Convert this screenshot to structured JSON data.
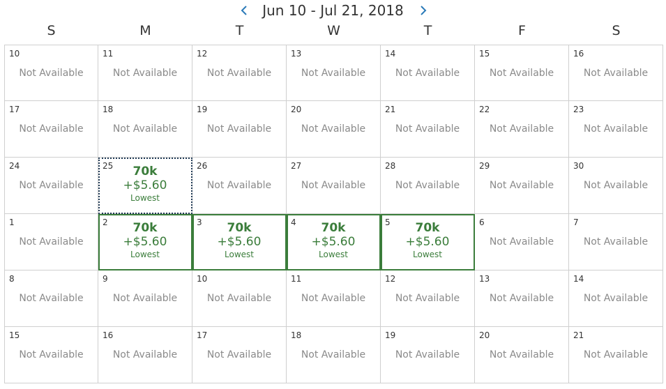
{
  "header": {
    "date_range": "Jun 10 - Jul 21, 2018",
    "prev_icon": "chevron-left-icon",
    "next_icon": "chevron-right-icon",
    "accent_color": "#2a7ab8"
  },
  "weekdays": [
    "S",
    "M",
    "T",
    "W",
    "T",
    "F",
    "S"
  ],
  "status_colors": {
    "available": "#3b7d3b",
    "not_available": "#8a8a8a"
  },
  "weeks": [
    [
      {
        "day": "10",
        "status": "Not Available"
      },
      {
        "day": "11",
        "status": "Not Available"
      },
      {
        "day": "12",
        "status": "Not Available"
      },
      {
        "day": "13",
        "status": "Not Available"
      },
      {
        "day": "14",
        "status": "Not Available"
      },
      {
        "day": "15",
        "status": "Not Available"
      },
      {
        "day": "16",
        "status": "Not Available"
      }
    ],
    [
      {
        "day": "17",
        "status": "Not Available"
      },
      {
        "day": "18",
        "status": "Not Available"
      },
      {
        "day": "19",
        "status": "Not Available"
      },
      {
        "day": "20",
        "status": "Not Available"
      },
      {
        "day": "21",
        "status": "Not Available"
      },
      {
        "day": "22",
        "status": "Not Available"
      },
      {
        "day": "23",
        "status": "Not Available"
      }
    ],
    [
      {
        "day": "24",
        "status": "Not Available"
      },
      {
        "day": "25",
        "points": "70k",
        "taxes": "+$5.60",
        "label": "Lowest",
        "focused": true
      },
      {
        "day": "26",
        "status": "Not Available"
      },
      {
        "day": "27",
        "status": "Not Available"
      },
      {
        "day": "28",
        "status": "Not Available"
      },
      {
        "day": "29",
        "status": "Not Available"
      },
      {
        "day": "30",
        "status": "Not Available"
      }
    ],
    [
      {
        "day": "1",
        "status": "Not Available"
      },
      {
        "day": "2",
        "points": "70k",
        "taxes": "+$5.60",
        "label": "Lowest"
      },
      {
        "day": "3",
        "points": "70k",
        "taxes": "+$5.60",
        "label": "Lowest"
      },
      {
        "day": "4",
        "points": "70k",
        "taxes": "+$5.60",
        "label": "Lowest"
      },
      {
        "day": "5",
        "points": "70k",
        "taxes": "+$5.60",
        "label": "Lowest"
      },
      {
        "day": "6",
        "status": "Not Available"
      },
      {
        "day": "7",
        "status": "Not Available"
      }
    ],
    [
      {
        "day": "8",
        "status": "Not Available"
      },
      {
        "day": "9",
        "status": "Not Available"
      },
      {
        "day": "10",
        "status": "Not Available"
      },
      {
        "day": "11",
        "status": "Not Available"
      },
      {
        "day": "12",
        "status": "Not Available"
      },
      {
        "day": "13",
        "status": "Not Available"
      },
      {
        "day": "14",
        "status": "Not Available"
      }
    ],
    [
      {
        "day": "15",
        "status": "Not Available"
      },
      {
        "day": "16",
        "status": "Not Available"
      },
      {
        "day": "17",
        "status": "Not Available"
      },
      {
        "day": "18",
        "status": "Not Available"
      },
      {
        "day": "19",
        "status": "Not Available"
      },
      {
        "day": "20",
        "status": "Not Available"
      },
      {
        "day": "21",
        "status": "Not Available"
      }
    ]
  ]
}
